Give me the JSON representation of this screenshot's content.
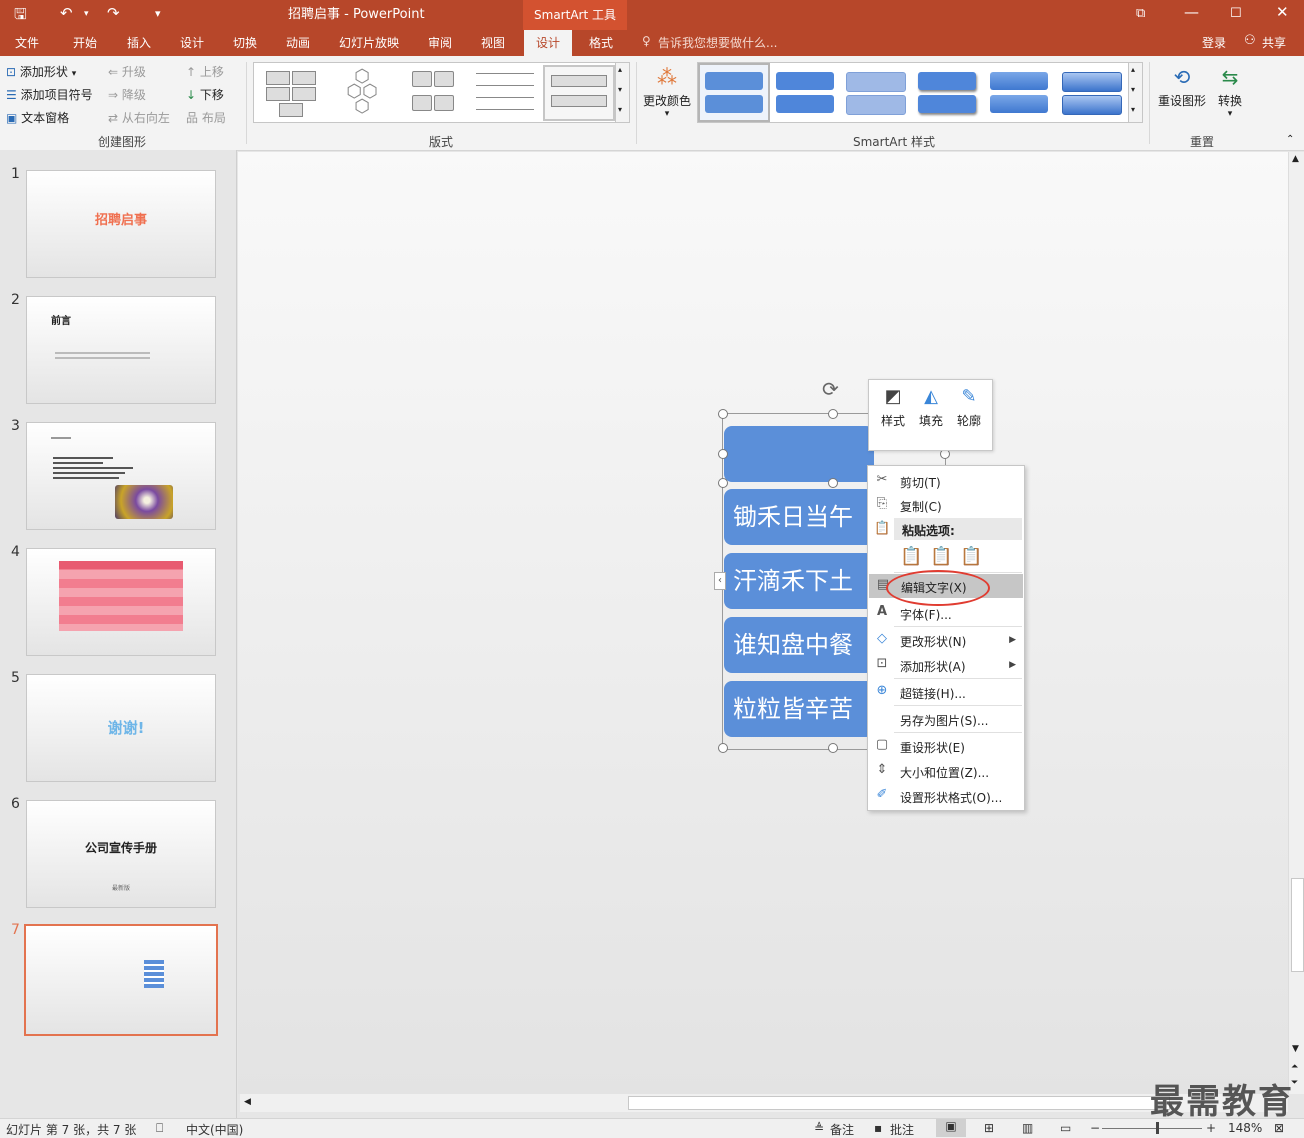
{
  "app": {
    "title": "招聘启事 - PowerPoint",
    "context_tab": "SmartArt 工具",
    "login": "登录",
    "share": "共享",
    "tell_me": "告诉我您想要做什么..."
  },
  "tabs": [
    "文件",
    "开始",
    "插入",
    "设计",
    "切换",
    "动画",
    "幻灯片放映",
    "审阅",
    "视图",
    "设计",
    "格式"
  ],
  "ribbon": {
    "create_graphic": {
      "add_shape": "添加形状",
      "add_bullet": "添加项目符号",
      "text_pane": "文本窗格",
      "promote": "升级",
      "demote": "降级",
      "right_to_left": "从右向左",
      "move_up": "上移",
      "move_down": "下移",
      "layout": "布局",
      "group_label": "创建图形"
    },
    "layouts_label": "版式",
    "change_colors": "更改颜色",
    "styles_label": "SmartArt 样式",
    "reset_graphic": "重设图形",
    "convert": "转换",
    "reset_label": "重置"
  },
  "slides": [
    {
      "num": "1",
      "title": "招聘启事"
    },
    {
      "num": "2",
      "title": "前言"
    },
    {
      "num": "3",
      "title": ""
    },
    {
      "num": "4",
      "title": ""
    },
    {
      "num": "5",
      "title": "谢谢!"
    },
    {
      "num": "6",
      "title": "公司宣传手册",
      "sub": "最新版"
    },
    {
      "num": "7",
      "title": ""
    }
  ],
  "smartart": {
    "items": [
      "",
      "锄禾日当午",
      "汗滴禾下土",
      "谁知盘中餐",
      "粒粒皆辛苦"
    ]
  },
  "mini_toolbar": {
    "style": "样式",
    "fill": "填充",
    "outline": "轮廓"
  },
  "context_menu": {
    "cut": "剪切(T)",
    "copy": "复制(C)",
    "paste_options": "粘贴选项:",
    "edit_text": "编辑文字(X)",
    "font": "字体(F)...",
    "change_shape": "更改形状(N)",
    "add_shape": "添加形状(A)",
    "hyperlink": "超链接(H)...",
    "save_as_picture": "另存为图片(S)...",
    "reset_shape": "重设形状(E)",
    "size_position": "大小和位置(Z)...",
    "format_shape": "设置形状格式(O)..."
  },
  "status": {
    "slide_info": "幻灯片 第 7 张，共 7 张",
    "language": "中文(中国)",
    "notes": "备注",
    "comments": "批注",
    "zoom": "148%"
  },
  "watermark": "最需教育",
  "colors": {
    "accent": "#b7472a",
    "smartart": "#5b8fd9",
    "highlight": "#e03c31"
  }
}
